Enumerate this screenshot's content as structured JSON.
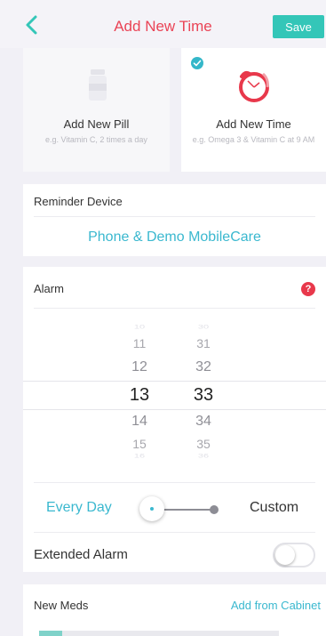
{
  "header": {
    "title": "Add New Time",
    "save_label": "Save",
    "back_icon": "chevron-left-icon"
  },
  "options": [
    {
      "label": "Add New Pill",
      "hint": "e.g. Vitamin C, 2 times a day",
      "icon": "pill-bottle-icon"
    },
    {
      "label": "Add New Time",
      "hint": "e.g. Omega 3 & Vitamin C at 9 AM",
      "icon": "alarm-clock-icon",
      "selected": true
    }
  ],
  "device": {
    "title": "Reminder Device",
    "value": "Phone & Demo MobileCare"
  },
  "alarm": {
    "title": "Alarm",
    "help_icon": "?",
    "hours": [
      "10",
      "11",
      "12",
      "13",
      "14",
      "15",
      "16"
    ],
    "minutes": [
      "30",
      "31",
      "32",
      "33",
      "34",
      "35",
      "36"
    ],
    "selected_hour": "13",
    "selected_minute": "33",
    "freq_left": "Every Day",
    "freq_right": "Custom",
    "extended_label": "Extended Alarm",
    "extended_on": false
  },
  "meds": {
    "title": "New Meds",
    "link": "Add from Cabinet"
  },
  "colors": {
    "accent": "#34c6b8",
    "link": "#3ab8cf",
    "title": "#ea4456",
    "help": "#e8384b"
  }
}
